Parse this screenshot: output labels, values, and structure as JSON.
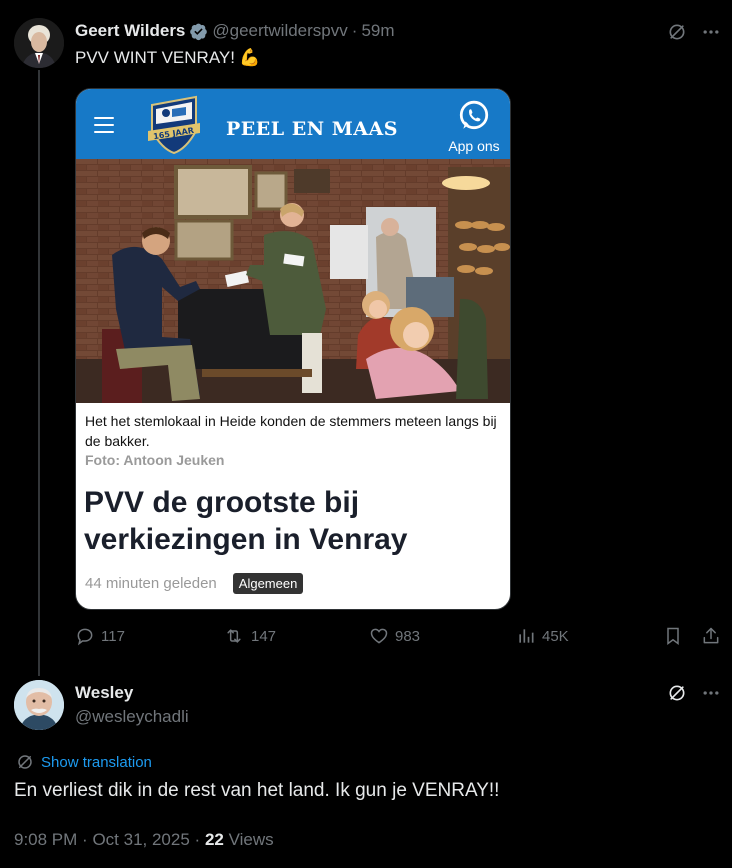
{
  "tweet1": {
    "name": "Geert Wilders",
    "handle": "@geertwilderspvv",
    "separator": "·",
    "time": "59m",
    "text": "PVV WINT VENRAY!",
    "emoji": "💪"
  },
  "card": {
    "brand": "PEEL EN MAAS",
    "crest_text": "165 JAAR",
    "app_label": "App ons",
    "caption": "Het het stemlokaal in Heide konden de stemmers meteen langs bij de bakker.",
    "credit": "Foto: Antoon Jeuken",
    "headline": "PVV de grootste bij verkiezingen in Venray",
    "ago": "44 minuten geleden",
    "tag": "Algemeen"
  },
  "actions": {
    "replies": "117",
    "reposts": "147",
    "likes": "983",
    "views": "45K"
  },
  "tweet2": {
    "name": "Wesley",
    "handle": "@wesleychadli",
    "translate": "Show translation",
    "text": "En verliest dik in de rest van het land. Ik gun je VENRAY!!",
    "time": "9:08 PM",
    "date": "Oct 31, 2025",
    "views_count": "22",
    "views_label": "Views",
    "sep": "·"
  },
  "colors": {
    "background": "#000000",
    "text": "#e7e9ea",
    "muted": "#71767b",
    "link": "#1d9bf0",
    "verified": "#829aab",
    "card_header": "#1779c7"
  },
  "icons": [
    "verified-badge-icon",
    "grok-icon",
    "more-icon",
    "menu-icon",
    "whatsapp-icon",
    "reply-icon",
    "repost-icon",
    "like-icon",
    "views-icon",
    "bookmark-icon",
    "share-icon",
    "translate-icon"
  ]
}
